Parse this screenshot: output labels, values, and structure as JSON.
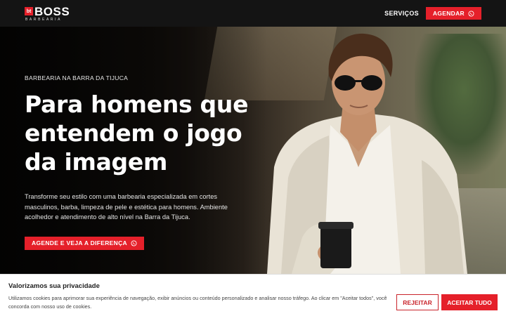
{
  "header": {
    "logo_badge": "bt",
    "logo_word": "BOSS",
    "logo_sub": "BARBEARIA",
    "nav_services": "SERVIÇOS",
    "nav_book": "AGENDAR",
    "whatsapp_icon": "whatsapp-icon"
  },
  "hero": {
    "eyebrow": "BARBEARIA NA BARRA DA TIJUCA",
    "headline_line1": "Para homens que",
    "headline_line2": "entendem o jogo",
    "headline_line3": "da imagem",
    "description": "Transforme seu estilo com uma barbearia especializada em cortes masculinos, barba, limpeza de pele e estética para homens. Ambiente acolhedor e atendimento de alto nível na Barra da Tijuca.",
    "cta": "AGENDE E VEJA A DIFERENÇA"
  },
  "cookie": {
    "title": "Valorizamos sua privacidade",
    "text": "Utilizamos cookies para aprimorar sua experiência de navegação, exibir anúncios ou conteúdo personalizado e analisar nosso tráfego. Ao clicar em \"Aceitar todos\", você concorda com nosso uso de cookies.",
    "reject": "REJEITAR",
    "accept": "ACEITAR TUDO"
  },
  "colors": {
    "accent": "#e5202a",
    "header_bg": "#141414"
  }
}
